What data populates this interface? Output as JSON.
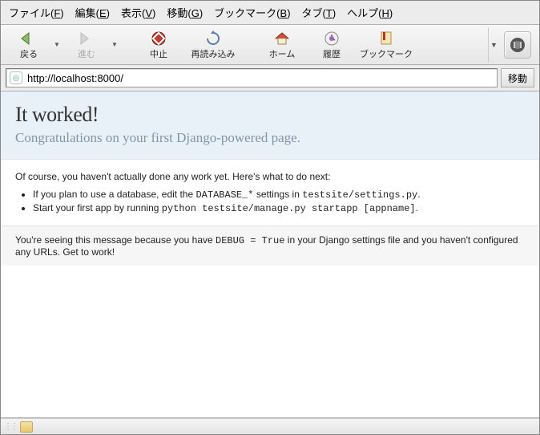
{
  "menubar": [
    {
      "prefix": "ファイル(",
      "accel": "F",
      "suffix": ")"
    },
    {
      "prefix": "編集(",
      "accel": "E",
      "suffix": ")"
    },
    {
      "prefix": "表示(",
      "accel": "V",
      "suffix": ")"
    },
    {
      "prefix": "移動(",
      "accel": "G",
      "suffix": ")"
    },
    {
      "prefix": "ブックマーク(",
      "accel": "B",
      "suffix": ")"
    },
    {
      "prefix": "タブ(",
      "accel": "T",
      "suffix": ")"
    },
    {
      "prefix": "ヘルプ(",
      "accel": "H",
      "suffix": ")"
    }
  ],
  "toolbar": {
    "back": "戻る",
    "forward": "進む",
    "stop": "中止",
    "reload": "再読み込み",
    "home": "ホーム",
    "history": "履歴",
    "bookmarks": "ブックマーク"
  },
  "address": {
    "url": "http://localhost:8000/",
    "go": "移動"
  },
  "page": {
    "title": "It worked!",
    "subtitle": "Congratulations on your first Django-powered page.",
    "intro": "Of course, you haven't actually done any work yet. Here's what to do next:",
    "li1_a": "If you plan to use a database, edit the ",
    "li1_b": "DATABASE_*",
    "li1_c": " settings in ",
    "li1_d": "testsite/settings.py",
    "li1_e": ".",
    "li2_a": "Start your first app by running ",
    "li2_b": "python testsite/manage.py startapp [appname]",
    "li2_c": ".",
    "footer_a": "You're seeing this message because you have ",
    "footer_b": "DEBUG = True",
    "footer_c": " in your Django settings file and you haven't configured any URLs. Get to work!"
  }
}
